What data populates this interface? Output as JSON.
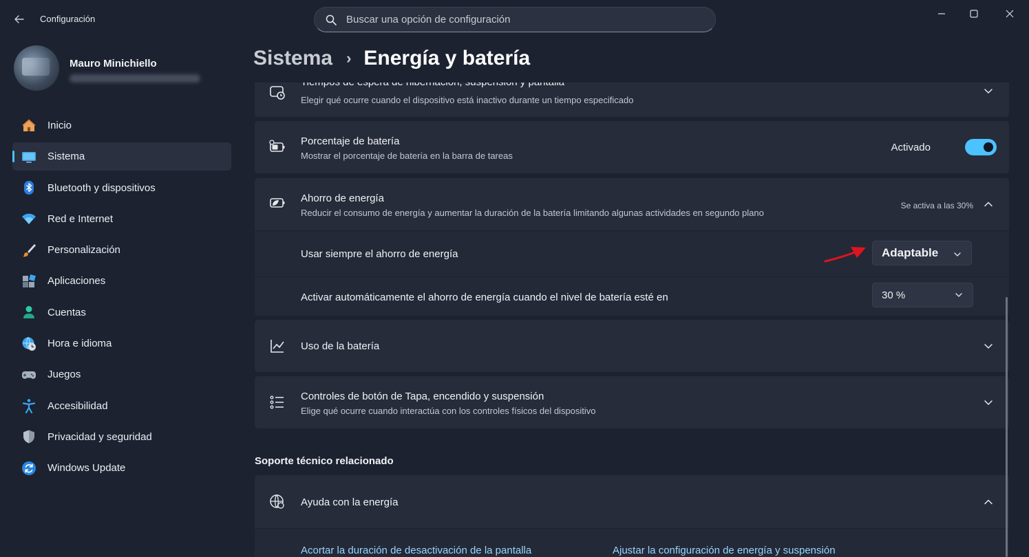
{
  "window": {
    "app_title": "Configuración",
    "search_placeholder": "Buscar una opción de configuración"
  },
  "profile": {
    "name": "Mauro Minichiello"
  },
  "sidebar": {
    "items": [
      {
        "label": "Inicio",
        "icon": "home-icon",
        "active": false
      },
      {
        "label": "Sistema",
        "icon": "monitor-icon",
        "active": true
      },
      {
        "label": "Bluetooth y dispositivos",
        "icon": "bluetooth-icon",
        "active": false
      },
      {
        "label": "Red e Internet",
        "icon": "wifi-icon",
        "active": false
      },
      {
        "label": "Personalización",
        "icon": "brush-icon",
        "active": false
      },
      {
        "label": "Aplicaciones",
        "icon": "apps-icon",
        "active": false
      },
      {
        "label": "Cuentas",
        "icon": "person-icon",
        "active": false
      },
      {
        "label": "Hora e idioma",
        "icon": "globe-clock-icon",
        "active": false
      },
      {
        "label": "Juegos",
        "icon": "gamepad-icon",
        "active": false
      },
      {
        "label": "Accesibilidad",
        "icon": "accessibility-icon",
        "active": false
      },
      {
        "label": "Privacidad y seguridad",
        "icon": "shield-icon",
        "active": false
      },
      {
        "label": "Windows Update",
        "icon": "update-icon",
        "active": false
      }
    ]
  },
  "breadcrumb": {
    "parent": "Sistema",
    "separator": "›",
    "current": "Energía y batería"
  },
  "settings": {
    "sleep": {
      "title": "Tiempos de espera de hibernación, suspensión y pantalla",
      "subtitle": "Elegir qué ocurre cuando el dispositivo está inactivo durante un tiempo especificado"
    },
    "battery_percent": {
      "title": "Porcentaje de batería",
      "subtitle": "Mostrar el porcentaje de batería en la barra de tareas",
      "toggle_label": "Activado",
      "toggle_on": true
    },
    "saver": {
      "title": "Ahorro de energía",
      "subtitle": "Reducir el consumo de energía y aumentar la duración de la batería limitando algunas actividades en segundo plano",
      "status": "Se activa a las 30%",
      "always_label": "Usar siempre el ahorro de energía",
      "always_value": "Adaptable",
      "auto_label": "Activar automáticamente el ahorro de energía cuando el nivel de batería esté en",
      "auto_value": "30 %"
    },
    "usage": {
      "title": "Uso de la batería"
    },
    "lid": {
      "title": "Controles de botón de Tapa, encendido y suspensión",
      "subtitle": "Elige qué ocurre cuando interactúa con los controles físicos del dispositivo"
    }
  },
  "support": {
    "section_title": "Soporte técnico relacionado",
    "help_title": "Ayuda con la energía",
    "links": [
      "Acortar la duración de desactivación de la pantalla",
      "Ajustar la configuración de energía y suspensión"
    ]
  },
  "colors": {
    "accent": "#4cc2ff",
    "annotation_arrow": "#e0141e"
  }
}
